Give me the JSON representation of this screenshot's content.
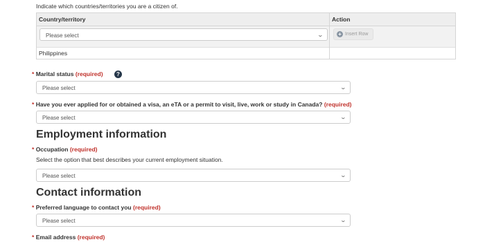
{
  "citizenship": {
    "intro": "Indicate which countries/territories you are a citizen of.",
    "col_country": "Country/territory",
    "col_action": "Action",
    "select_placeholder": "Please select",
    "insert_row": "Insert Row",
    "existing_value": "Philippines"
  },
  "marital": {
    "star": "*",
    "label": "Marital status",
    "required": "(required)",
    "help_icon": "question-circle-icon",
    "select_value": "Please select"
  },
  "visa": {
    "star": "*",
    "label": "Have you ever applied for or obtained a visa, an eTA or a permit to visit, live, work or study in Canada?",
    "required": "(required)",
    "select_value": "Please select"
  },
  "employment": {
    "heading": "Employment information",
    "star": "*",
    "label": "Occupation",
    "required": "(required)",
    "description": "Select the option that best describes your current employment situation.",
    "select_value": "Please select"
  },
  "contact": {
    "heading": "Contact information",
    "star": "*",
    "label": "Preferred language to contact you",
    "required": "(required)",
    "select_value": "Please select"
  },
  "email": {
    "star": "*",
    "label": "Email address",
    "required": "(required)"
  },
  "colors": {
    "required_red": "#c0302a",
    "help_icon_navy": "#26374a",
    "table_header_bg": "#eeeeee"
  }
}
